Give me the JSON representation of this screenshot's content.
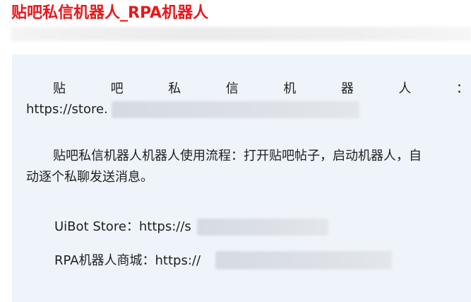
{
  "article": {
    "title": "贴吧私信机器人_RPA机器人",
    "intro_chars": [
      "贴",
      "吧",
      "私",
      "信",
      "机",
      "器",
      "人",
      "："
    ],
    "intro_url": "https://store.",
    "usage_line1": "贴吧私信机器人机器人使用流程：打开贴吧帖子，启动机器人，自",
    "usage_line2": "动逐个私聊发送消息。",
    "uibot_store_text": "UiBot Store：https://s",
    "rpa_store_text": "RPA机器人商城：https://"
  },
  "colors": {
    "title": "#e8171b",
    "content_background": "#eef4fa",
    "text": "#1f1f1f"
  }
}
